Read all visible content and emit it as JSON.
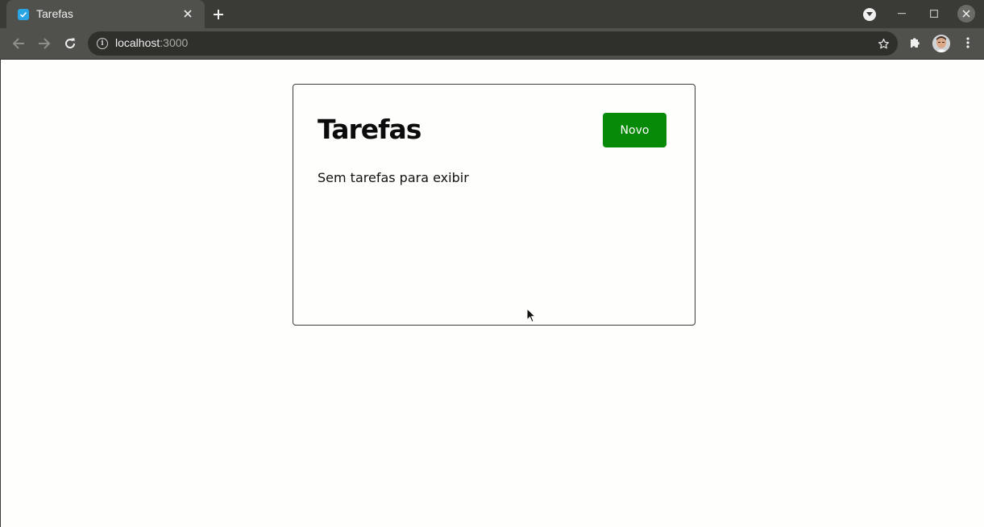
{
  "browser": {
    "tab": {
      "title": "Tarefas",
      "favicon": "check-icon",
      "favicon_color": "#29a5e6"
    },
    "address_bar": {
      "host": "localhost",
      "port": ":3000"
    }
  },
  "page": {
    "title": "Tarefas",
    "new_button_label": "Novo",
    "new_button_color": "#078a07",
    "empty_message": "Sem tarefas para exibir"
  }
}
